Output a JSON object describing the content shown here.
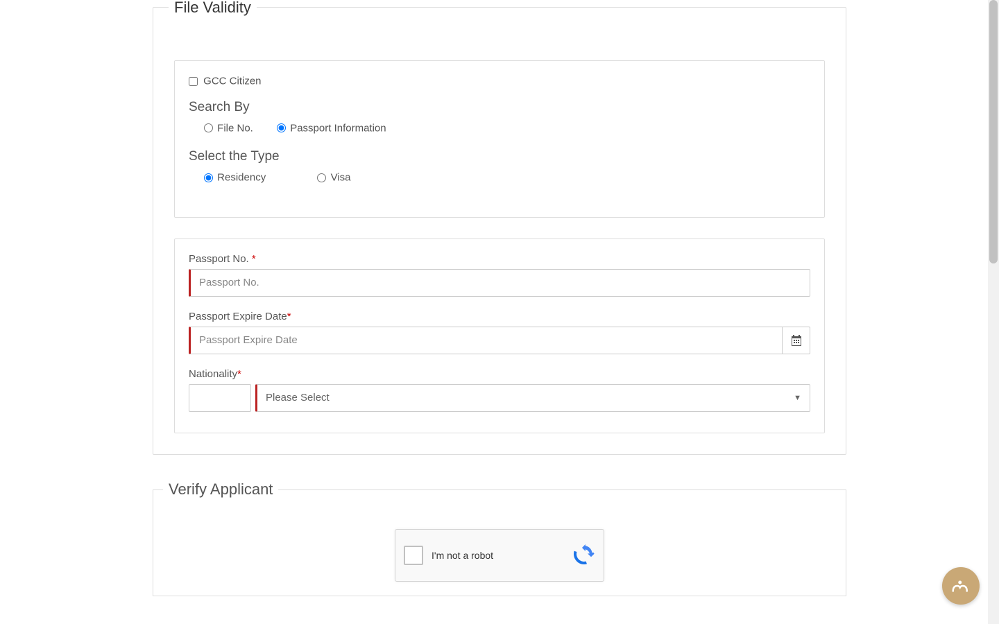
{
  "legend": "File Validity",
  "gcc_checkbox": {
    "label": "GCC Citizen",
    "checked": false
  },
  "search_by": {
    "heading": "Search By",
    "options": {
      "file_no": "File No.",
      "passport_info": "Passport Information"
    },
    "selected": "passport_info"
  },
  "select_type": {
    "heading": "Select the Type",
    "options": {
      "residency": "Residency",
      "visa": "Visa"
    },
    "selected": "residency"
  },
  "fields": {
    "passport_no": {
      "label": "Passport No. ",
      "placeholder": "Passport No.",
      "value": ""
    },
    "passport_expire": {
      "label": "Passport Expire Date",
      "placeholder": "Passport Expire Date",
      "value": ""
    },
    "nationality": {
      "label": "Nationality",
      "code_value": "",
      "select_placeholder": "Please Select"
    }
  },
  "verify": {
    "legend": "Verify Applicant",
    "recaptcha_text": "I'm not a robot"
  },
  "required_mark": "*"
}
